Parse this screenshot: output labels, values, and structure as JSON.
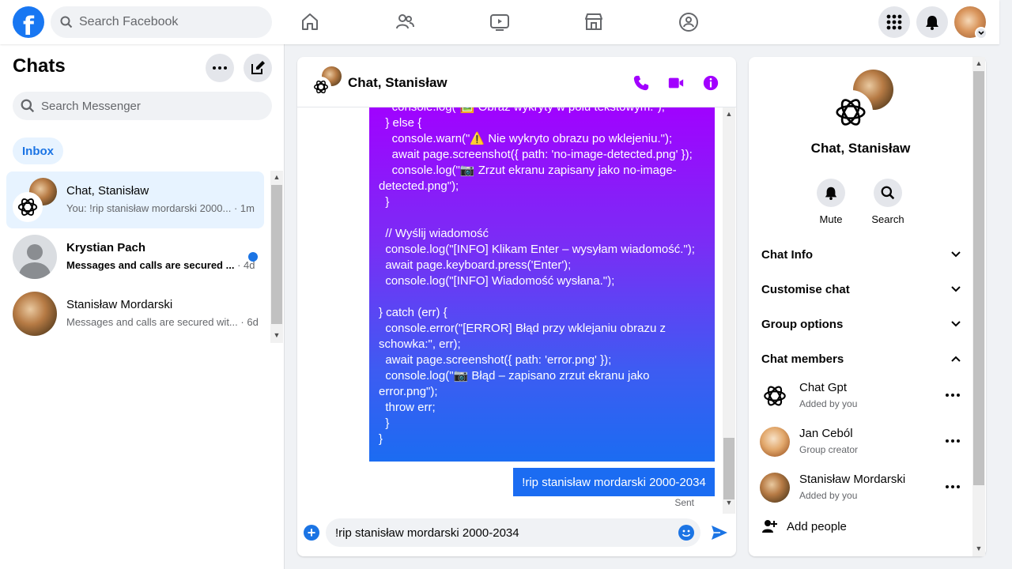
{
  "topbar": {
    "logo": "f",
    "search_placeholder": "Search Facebook",
    "icons": [
      "home-icon",
      "friends-icon",
      "watch-icon",
      "marketplace-icon",
      "groups-icon",
      "menu-grid-icon",
      "notifications-icon",
      "account-avatar"
    ]
  },
  "sidebar": {
    "title": "Chats",
    "search_placeholder": "Search Messenger",
    "filter": "Inbox",
    "chats": [
      {
        "name": "Chat, Stanisław",
        "preview": "You: !rip stanisław mordarski 2000...",
        "time": "· 1m"
      },
      {
        "name": "Krystian Pach",
        "preview": "Messages and calls are secured ...",
        "time": "· 4d"
      },
      {
        "name": "Stanisław Mordarski",
        "preview": "Messages and calls are secured wit...",
        "time": "· 6d"
      }
    ]
  },
  "conversation": {
    "title": "Chat, Stanisław",
    "code_lines": [
      "    console.log(\"🖼️ Obraz wykryty w polu tekstowym.\");",
      "  } else {",
      "    console.warn(\"⚠️ Nie wykryto obrazu po wklejeniu.\");",
      "    await page.screenshot({ path: 'no-image-detected.png' });",
      "    console.log(\"📷 Zrzut ekranu zapisany jako no-image-",
      "detected.png\");",
      "  }",
      "",
      "  // Wyślij wiadomość",
      "  console.log(\"[INFO] Klikam Enter – wysyłam wiadomość.\");",
      "  await page.keyboard.press('Enter');",
      "  console.log(\"[INFO] Wiadomość wysłana.\");",
      "",
      "} catch (err) {",
      "  console.error(\"[ERROR] Błąd przy wklejaniu obrazu z",
      "schowka:\", err);",
      "  await page.screenshot({ path: 'error.png' });",
      "  console.log(\"📷 Błąd – zapisano zrzut ekranu jako",
      "error.png\");",
      "  throw err;",
      "  }",
      "}"
    ],
    "last_message": "!rip stanisław mordarski 2000-2034",
    "status": "Sent",
    "composer_value": "!rip stanisław mordarski 2000-2034"
  },
  "details": {
    "name": "Chat, Stanisław",
    "actions": [
      "Mute",
      "Search"
    ],
    "sections": [
      "Chat Info",
      "Customise chat",
      "Group options",
      "Chat members"
    ],
    "members": [
      {
        "name": "Chat Gpt",
        "role": "Added by you"
      },
      {
        "name": "Jan Ceból",
        "role": "Group creator"
      },
      {
        "name": "Stanisław Mordarski",
        "role": "Added by you"
      }
    ],
    "add_people": "Add people"
  },
  "colors": {
    "brand": "#1877f2",
    "accent": "#a200ff",
    "bubble_blue": "#1b6cf2"
  }
}
